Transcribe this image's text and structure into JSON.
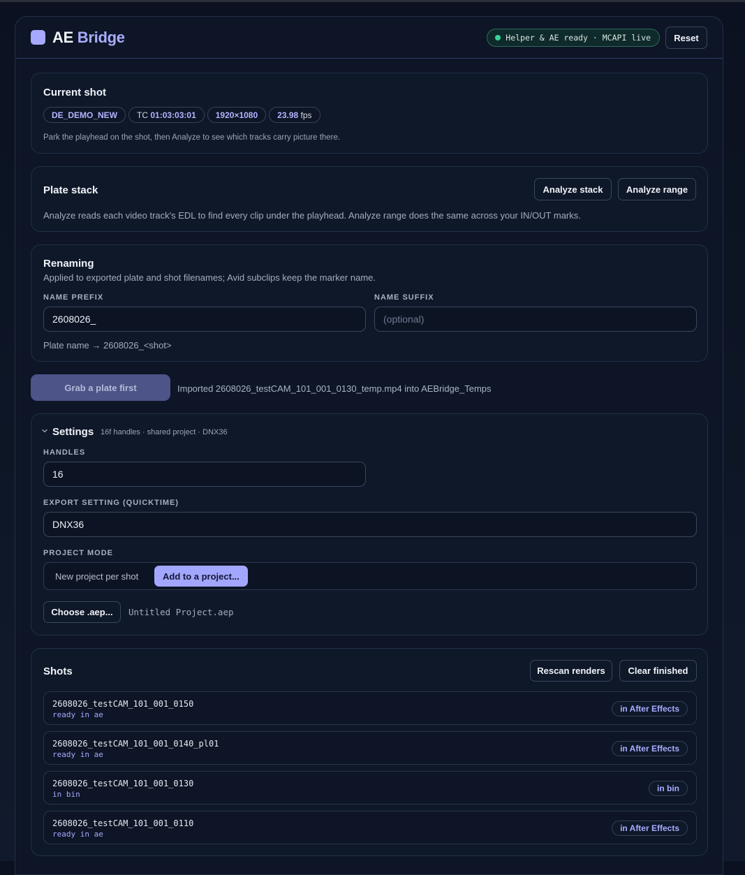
{
  "app": {
    "title_main": "AE",
    "title_accent": "Bridge",
    "status": "Helper & AE ready · MCAPI live",
    "reset_label": "Reset",
    "colors": {
      "accent": "#a6a9ff",
      "status_ok": "#35d39a",
      "background": "#0d1526"
    }
  },
  "current_shot": {
    "title": "Current shot",
    "shot_name": "DE_DEMO_NEW",
    "tc_prefix": "TC",
    "timecode": "01:03:03:01",
    "resolution": "1920×1080",
    "fps_value": "23.98",
    "fps_unit": "fps",
    "hint": "Park the playhead on the shot, then Analyze to see which tracks carry picture there."
  },
  "plate_stack": {
    "title": "Plate stack",
    "analyze_stack_label": "Analyze stack",
    "analyze_range_label": "Analyze range",
    "description": "Analyze reads each video track's EDL to find every clip under the playhead. Analyze range does the same across your IN/OUT marks."
  },
  "renaming": {
    "title": "Renaming",
    "description": "Applied to exported plate and shot filenames; Avid subclips keep the marker name.",
    "prefix_label": "NAME PREFIX",
    "prefix_value": "2608026_",
    "suffix_label": "NAME SUFFIX",
    "suffix_placeholder": "(optional)",
    "preview_label": "Plate name →",
    "preview_value": "2608026_<shot>"
  },
  "grab": {
    "button_label": "Grab a plate first",
    "message": "Imported 2608026_testCAM_101_001_0130_temp.mp4 into AEBridge_Temps"
  },
  "settings": {
    "title": "Settings",
    "summary": "16f handles · shared project · DNX36",
    "handles_label": "HANDLES",
    "handles_value": "16",
    "export_label": "EXPORT SETTING (QUICKTIME)",
    "export_value": "DNX36",
    "mode_label": "PROJECT MODE",
    "mode_options": [
      "New project per shot",
      "Add to a project..."
    ],
    "mode_selected": "Add to a project...",
    "choose_label": "Choose .aep...",
    "project_file": "Untitled Project.aep"
  },
  "shots": {
    "title": "Shots",
    "rescan_label": "Rescan renders",
    "clear_label": "Clear finished",
    "rows": [
      {
        "name": "2608026_testCAM_101_001_0150",
        "status": "ready in ae",
        "badge": "in After Effects"
      },
      {
        "name": "2608026_testCAM_101_001_0140_pl01",
        "status": "ready in ae",
        "badge": "in After Effects"
      },
      {
        "name": "2608026_testCAM_101_001_0130",
        "status": "in bin",
        "badge": "in bin"
      },
      {
        "name": "2608026_testCAM_101_001_0110",
        "status": "ready in ae",
        "badge": "in After Effects"
      }
    ]
  }
}
